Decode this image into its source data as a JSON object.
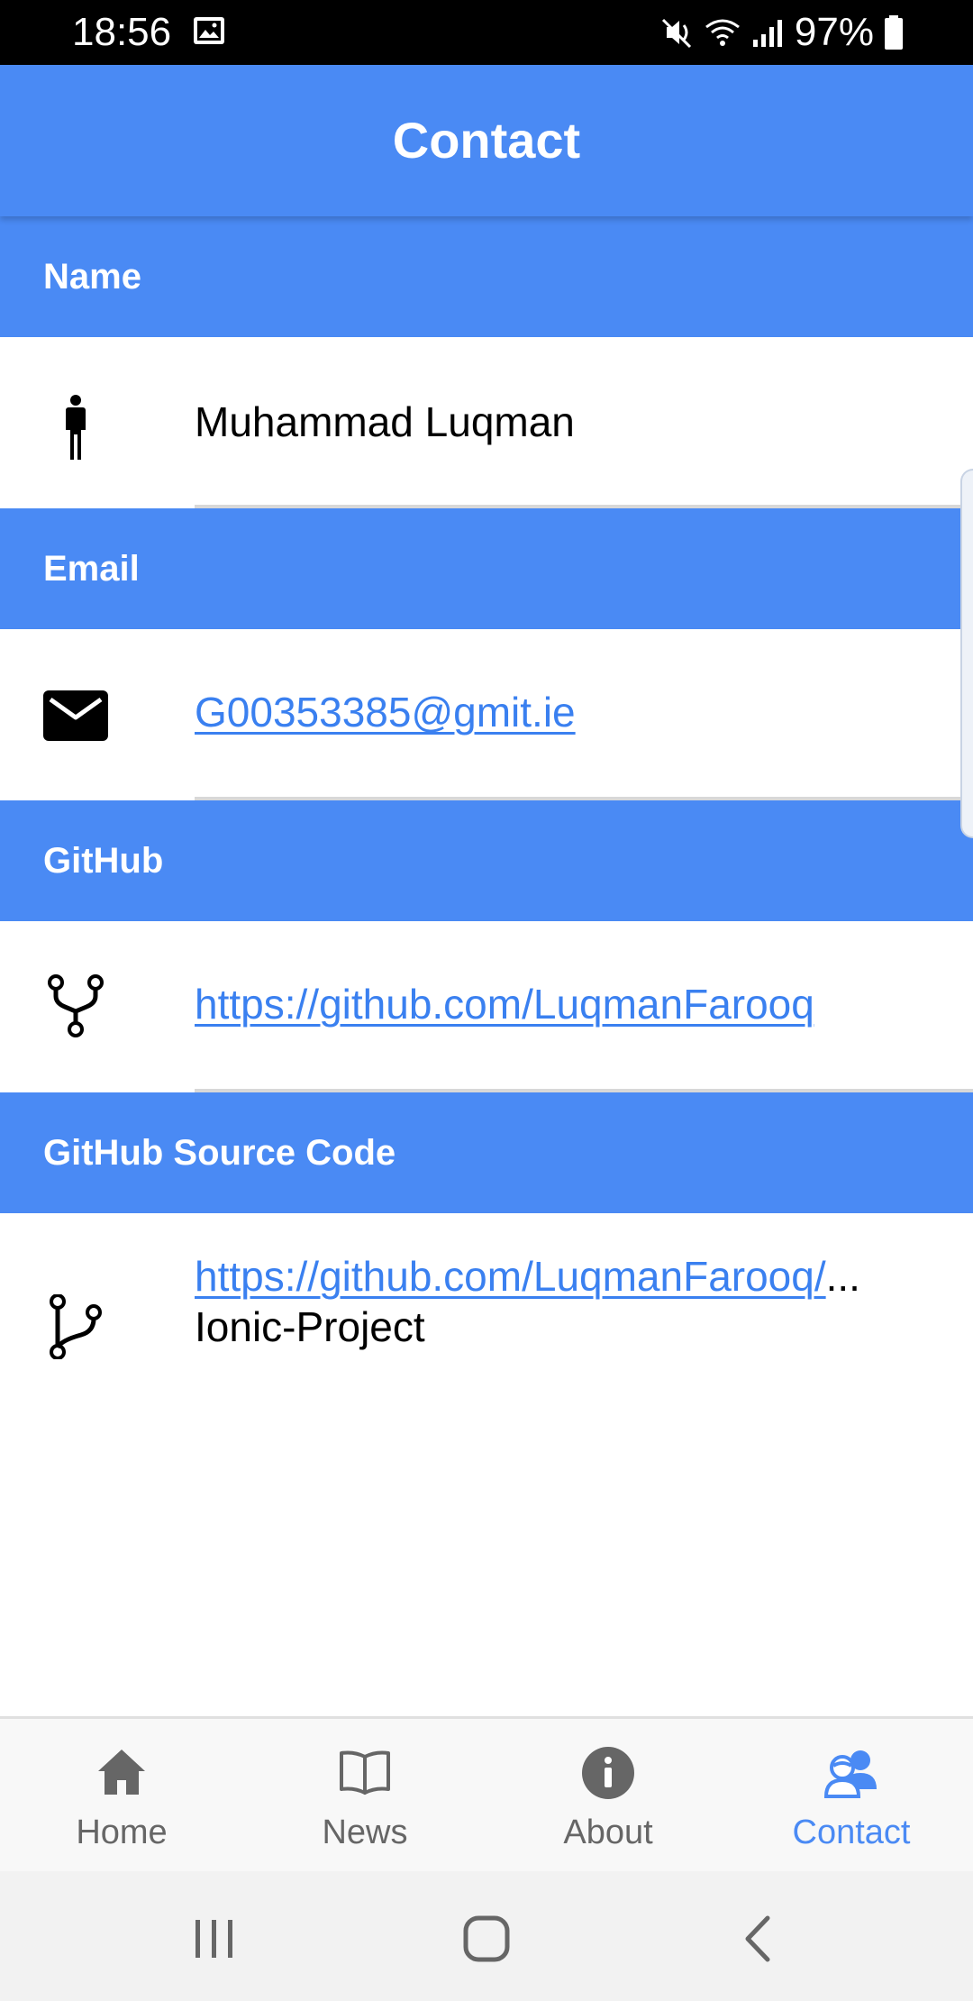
{
  "status_bar": {
    "time": "18:56",
    "battery": "97%"
  },
  "header": {
    "title": "Contact"
  },
  "sections": [
    {
      "heading": "Name",
      "icon": "person-icon",
      "value": "Muhammad Luqman"
    },
    {
      "heading": "Email",
      "icon": "mail-icon",
      "value": "G00353385@gmit.ie"
    },
    {
      "heading": "GitHub",
      "icon": "git-network-icon",
      "value": "https://github.com/LuqmanFarooq"
    },
    {
      "heading": "GitHub Source Code",
      "icon": "git-branch-icon",
      "value_line1": "https://github.com/LuqmanFarooq/",
      "ellipsis": "...",
      "value_line2": "Ionic-Project"
    }
  ],
  "tabs": [
    {
      "label": "Home",
      "icon": "home-icon",
      "active": false
    },
    {
      "label": "News",
      "icon": "book-icon",
      "active": false
    },
    {
      "label": "About",
      "icon": "info-icon",
      "active": false
    },
    {
      "label": "Contact",
      "icon": "people-icon",
      "active": true
    }
  ],
  "colors": {
    "primary": "#4a8af4",
    "link": "#3a80f0",
    "tab_inactive": "#666666"
  },
  "nav_bar": {
    "buttons": [
      "recents-icon",
      "home-circle-icon",
      "back-icon"
    ]
  }
}
